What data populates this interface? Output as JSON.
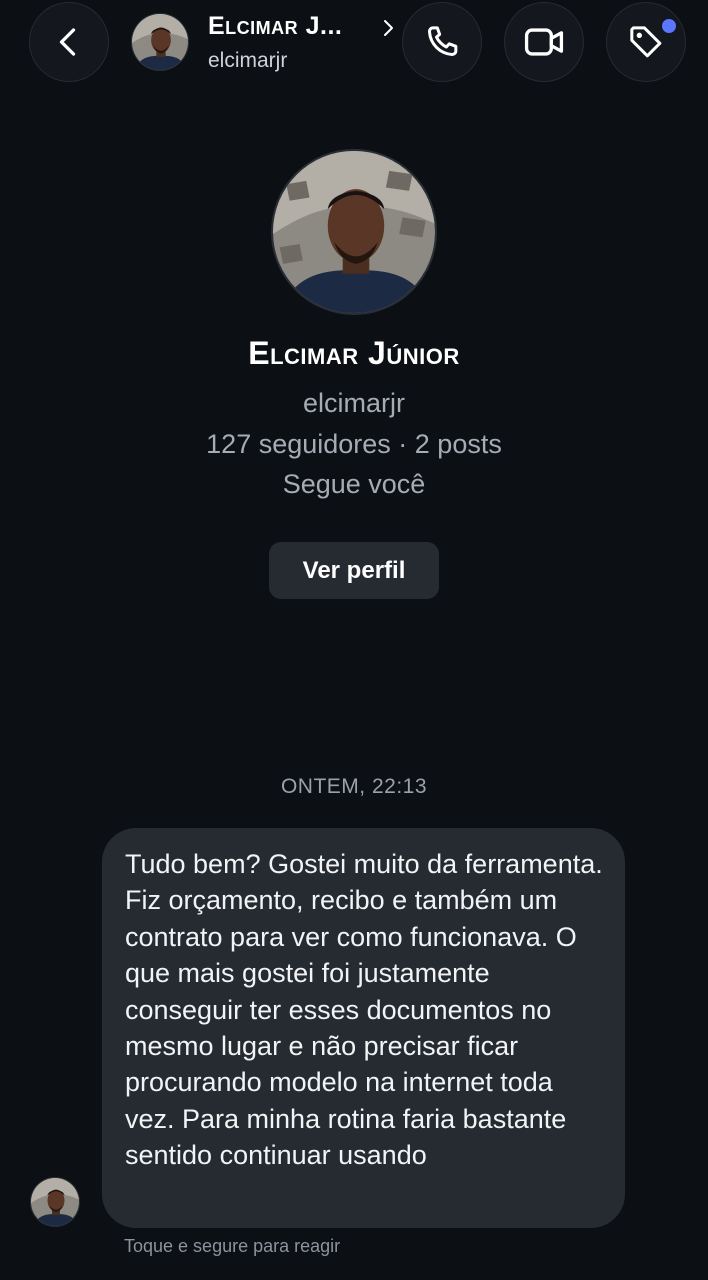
{
  "header": {
    "name": "Elcimar J...",
    "username": "elcimarjr"
  },
  "profile": {
    "name": "Elcimar Júnior",
    "username": "elcimarjr",
    "stats": "127 seguidores · 2 posts",
    "follows_you": "Segue você",
    "view_profile_label": "Ver perfil"
  },
  "conversation": {
    "timestamp": "ONTEM, 22:13",
    "messages": [
      {
        "text": "Tudo bem? Gostei muito da ferramenta. Fiz orçamento, recibo e também um contrato para ver como funcionava. O que mais gostei foi justamente conseguir ter esses documentos no mesmo lugar e não precisar ficar procurando modelo na internet toda vez. Para minha rotina faria bastante sentido continuar usando"
      }
    ],
    "reaction_hint": "Toque e segure para reagir"
  },
  "icons": {
    "back": "chevron-left-icon",
    "call": "phone-icon",
    "video": "video-camera-icon",
    "tag": "tag-icon",
    "chevron": "chevron-right-icon"
  },
  "colors": {
    "background": "#0c0f14",
    "bubble": "#262a31",
    "notification_dot": "#5b76ff",
    "secondary_text": "#a5acb6"
  }
}
